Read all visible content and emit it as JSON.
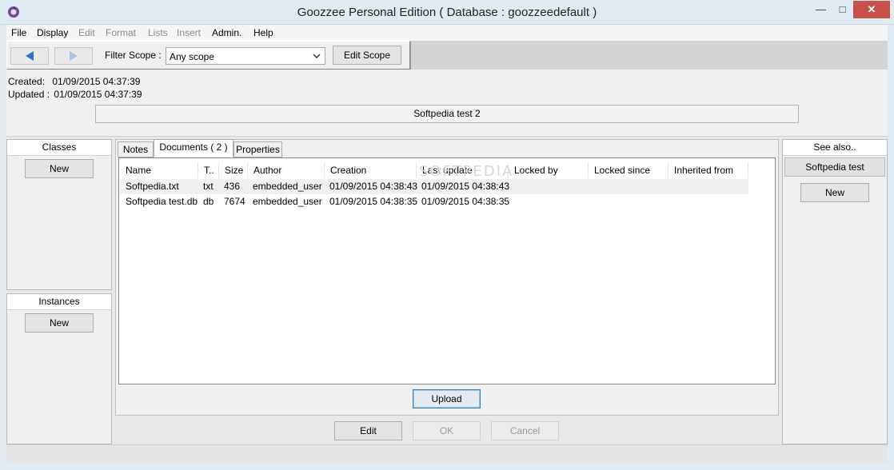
{
  "window": {
    "title": "Goozzee Personal Edition ( Database : goozzeedefault )"
  },
  "menu": [
    {
      "label": "File",
      "enabled": true
    },
    {
      "label": "Display",
      "enabled": true
    },
    {
      "label": "Edit",
      "enabled": false
    },
    {
      "label": "Format",
      "enabled": false
    },
    {
      "label": "Lists",
      "enabled": false
    },
    {
      "label": "Insert",
      "enabled": false
    },
    {
      "label": "Admin.",
      "enabled": true
    },
    {
      "label": "Help",
      "enabled": true
    }
  ],
  "toolbar": {
    "back_icon": "back-arrow-icon",
    "forward_icon": "forward-arrow-icon",
    "filter_label": "Filter Scope :",
    "scope_value": "Any scope",
    "edit_scope_label": "Edit Scope"
  },
  "record": {
    "created_label": "Created:",
    "created_value": "01/09/2015 04:37:39",
    "updated_label": "Updated :",
    "updated_value": "01/09/2015 04:37:39",
    "title": "Softpedia test 2"
  },
  "classes_panel": {
    "header": "Classes",
    "new_label": "New"
  },
  "instances_panel": {
    "header": "Instances",
    "new_label": "New"
  },
  "see_also_panel": {
    "header": "See also..",
    "item": "Softpedia test",
    "new_label": "New"
  },
  "tabs": [
    {
      "label": "Notes",
      "active": false
    },
    {
      "label": "Documents ( 2 )",
      "active": true
    },
    {
      "label": "Properties",
      "active": false
    }
  ],
  "documents": {
    "columns": [
      "Name",
      "T..",
      "Size",
      "Author",
      "Creation",
      "Last update",
      "Locked by",
      "Locked since",
      "Inherited from"
    ],
    "rows": [
      [
        "Softpedia.txt",
        "txt",
        "436",
        "embedded_user",
        "01/09/2015 04:38:43",
        "01/09/2015 04:38:43",
        "",
        "",
        ""
      ],
      [
        "Softpedia test.db",
        "db",
        "7674",
        "embedded_user",
        "01/09/2015 04:38:35",
        "01/09/2015 04:38:35",
        "",
        "",
        ""
      ]
    ],
    "upload_label": "Upload"
  },
  "actions": {
    "edit_label": "Edit",
    "ok_label": "OK",
    "cancel_label": "Cancel"
  },
  "watermark": "SOFTPEDIA",
  "colors": {
    "accent_arrow": "#2f6fc8",
    "selected_row": "#f0f0f0"
  }
}
